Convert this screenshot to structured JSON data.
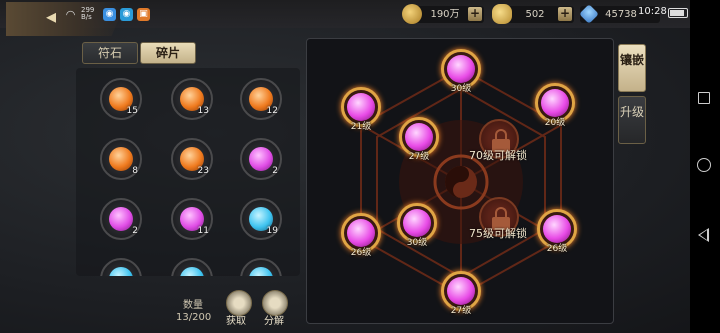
{
  "status_bar": {
    "net_rate": "299 B/s",
    "time": "10:28"
  },
  "currency": {
    "coin": "190万",
    "ingot": "502",
    "gem": "45738"
  },
  "inventory": {
    "tabs": [
      "符石",
      "碎片"
    ],
    "active_tab": "碎片",
    "items": [
      {
        "color": "orange",
        "count": "15"
      },
      {
        "color": "orange",
        "count": "13"
      },
      {
        "color": "orange",
        "count": "12"
      },
      {
        "color": "orange",
        "count": "8"
      },
      {
        "color": "orange",
        "count": "23"
      },
      {
        "color": "magenta",
        "count": "2"
      },
      {
        "color": "magenta",
        "count": "2"
      },
      {
        "color": "magenta",
        "count": "11"
      },
      {
        "color": "cyan",
        "count": "19"
      }
    ],
    "quantity_label": "数量",
    "quantity_value": "13/200",
    "acquire_label": "获取",
    "decompose_label": "分解"
  },
  "side_tabs": {
    "inlay": "镶嵌",
    "upgrade": "升级"
  },
  "board": {
    "nodes": [
      {
        "id": "top",
        "level": "30级"
      },
      {
        "id": "upper-left",
        "level": "21级"
      },
      {
        "id": "upper-right",
        "level": "20级"
      },
      {
        "id": "inner-left-top",
        "level": "27级"
      },
      {
        "id": "inner-left-bottom",
        "level": "30级"
      },
      {
        "id": "lower-left",
        "level": "26级"
      },
      {
        "id": "lower-right",
        "level": "26级"
      },
      {
        "id": "bottom",
        "level": "27级"
      }
    ],
    "locks": [
      {
        "id": "lock-70",
        "text": "70级可解锁"
      },
      {
        "id": "lock-75",
        "text": "75级可解锁"
      }
    ]
  }
}
